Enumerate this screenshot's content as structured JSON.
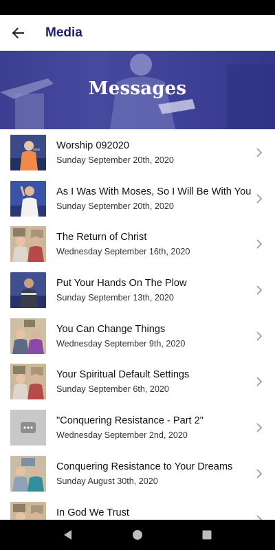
{
  "header": {
    "title": "Media",
    "back_icon": "arrow-left-icon"
  },
  "hero": {
    "title": "Messages"
  },
  "colors": {
    "brand": "#1c1f6b",
    "hero_tint": "#3a3d8e"
  },
  "messages": [
    {
      "title": "Worship 092020",
      "date": "Sunday September 20th, 2020",
      "thumb": "speaker-orange"
    },
    {
      "title": "As I Was With Moses, So I Will Be With You",
      "date": "Sunday September 20th, 2020",
      "thumb": "speaker-white"
    },
    {
      "title": "The Return of Christ",
      "date": "Wednesday September 16th, 2020",
      "thumb": "couple-red"
    },
    {
      "title": "Put Your Hands On The Plow",
      "date": "Sunday September 13th, 2020",
      "thumb": "speaker-dark"
    },
    {
      "title": "You Can Change Things",
      "date": "Wednesday September 9th, 2020",
      "thumb": "couple-purple"
    },
    {
      "title": "Your Spiritual Default Settings",
      "date": "Sunday September 6th, 2020",
      "thumb": "couple-red"
    },
    {
      "title": "\"Conquering Resistance - Part 2\"",
      "date": "Wednesday September 2nd, 2020",
      "thumb": "placeholder"
    },
    {
      "title": "Conquering Resistance to Your Dreams",
      "date": "Sunday August 30th, 2020",
      "thumb": "couple-teal"
    },
    {
      "title": "In God We Trust",
      "date": "",
      "thumb": "couple-red"
    }
  ],
  "nav": {
    "back": "triangle-back-icon",
    "home": "circle-home-icon",
    "recents": "square-recents-icon"
  }
}
